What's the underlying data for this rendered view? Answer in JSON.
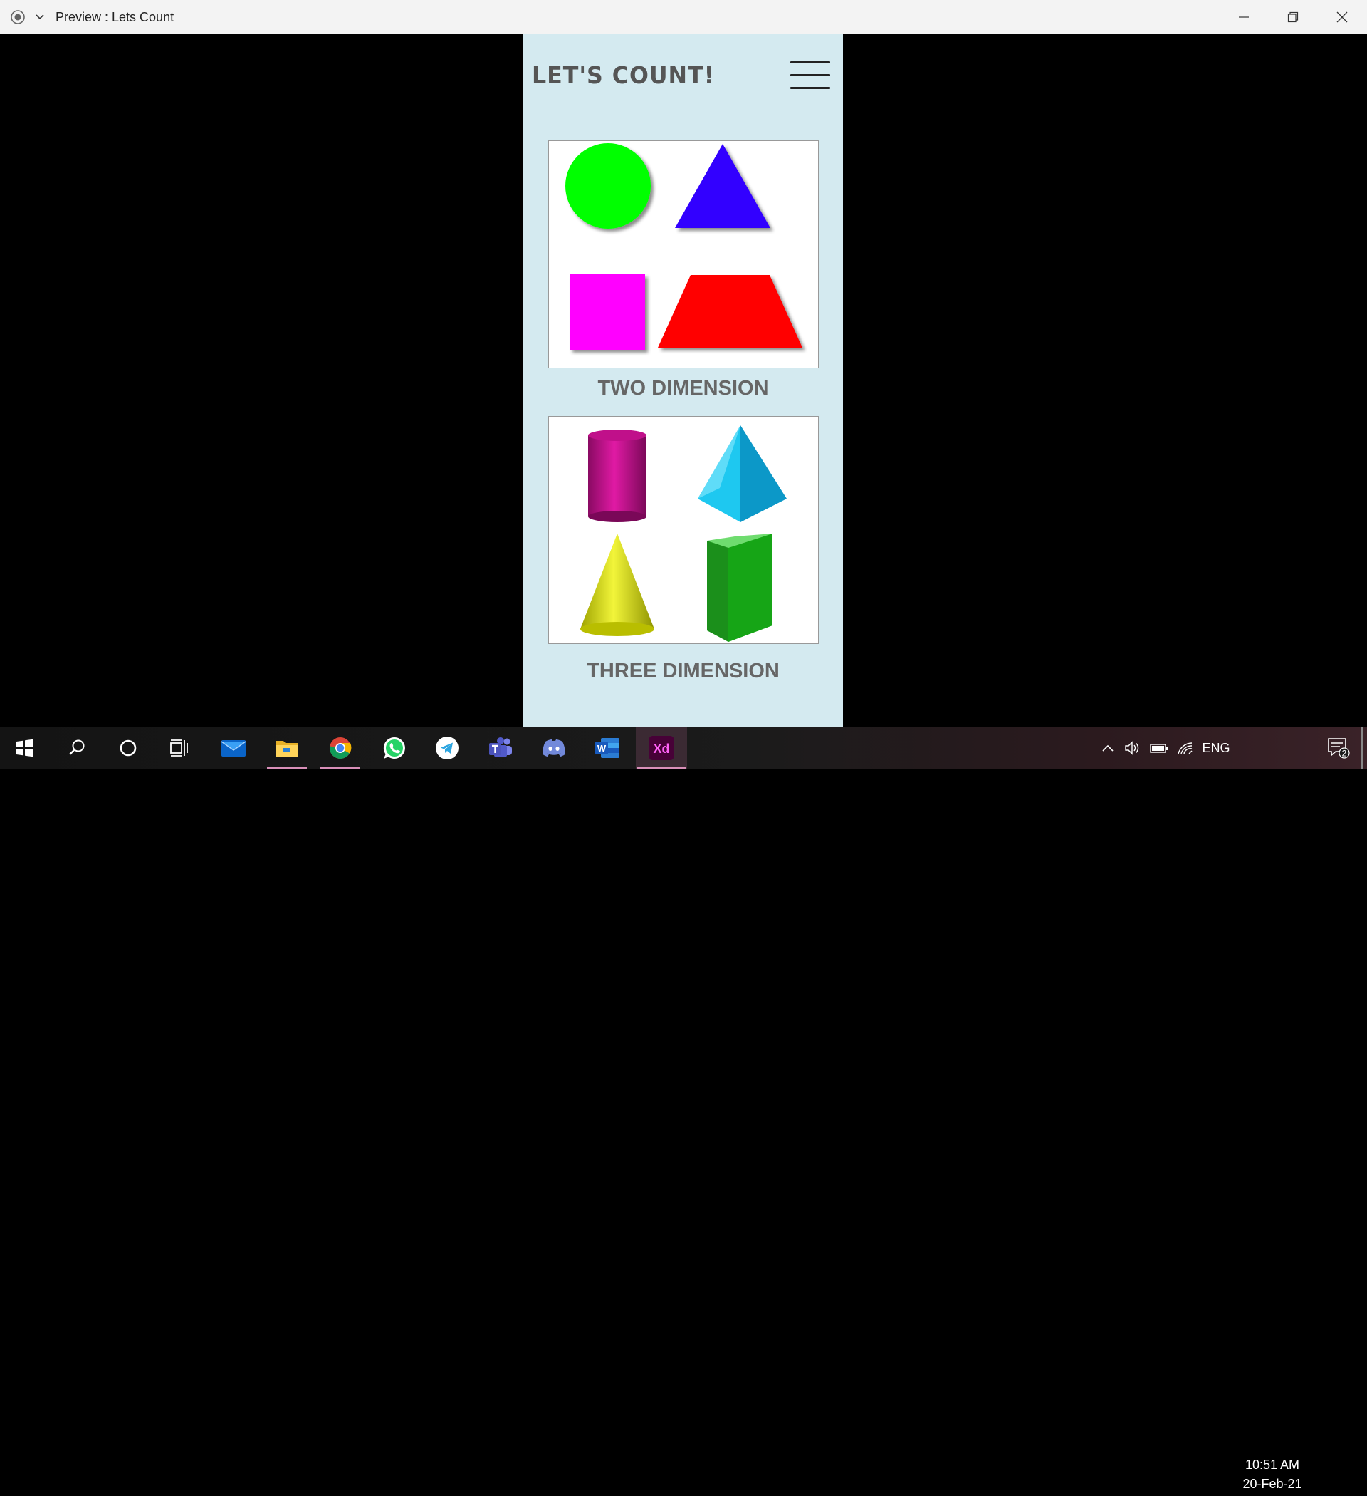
{
  "window": {
    "title": "Preview : Lets Count",
    "menu_icon": "record-icon",
    "controls": [
      "minimize-icon",
      "restore-icon",
      "close-icon"
    ]
  },
  "app": {
    "title": "LET'S COUNT!",
    "menu_icon": "hamburger-menu-icon",
    "background": "#d4eaf0",
    "sections": [
      {
        "label": "TWO DIMENSION",
        "shapes": [
          {
            "name": "circle",
            "color": "#00ff00"
          },
          {
            "name": "triangle",
            "color": "#3300ff"
          },
          {
            "name": "square",
            "color": "#ff00ff"
          },
          {
            "name": "trapezoid",
            "color": "#ff0000"
          }
        ]
      },
      {
        "label": "THREE DIMENSION",
        "shapes": [
          {
            "name": "cylinder",
            "color": "#c0108a"
          },
          {
            "name": "pyramid",
            "color": "#1ec8f0"
          },
          {
            "name": "cone",
            "color": "#d8e000"
          },
          {
            "name": "triangular-prism",
            "color": "#1aa81a"
          }
        ]
      }
    ]
  },
  "taskbar": {
    "apps": [
      "start-icon",
      "search-icon",
      "cortana-icon",
      "task-view-icon",
      "mail-icon",
      "file-explorer-icon",
      "chrome-icon",
      "whatsapp-icon",
      "telegram-icon",
      "teams-icon",
      "discord-icon",
      "word-icon",
      "adobe-xd-icon"
    ],
    "word_label": "W",
    "xd_label": "Xd",
    "language": "ENG",
    "time": "10:51 AM",
    "date": "20-Feb-21",
    "notification_count": "2"
  }
}
